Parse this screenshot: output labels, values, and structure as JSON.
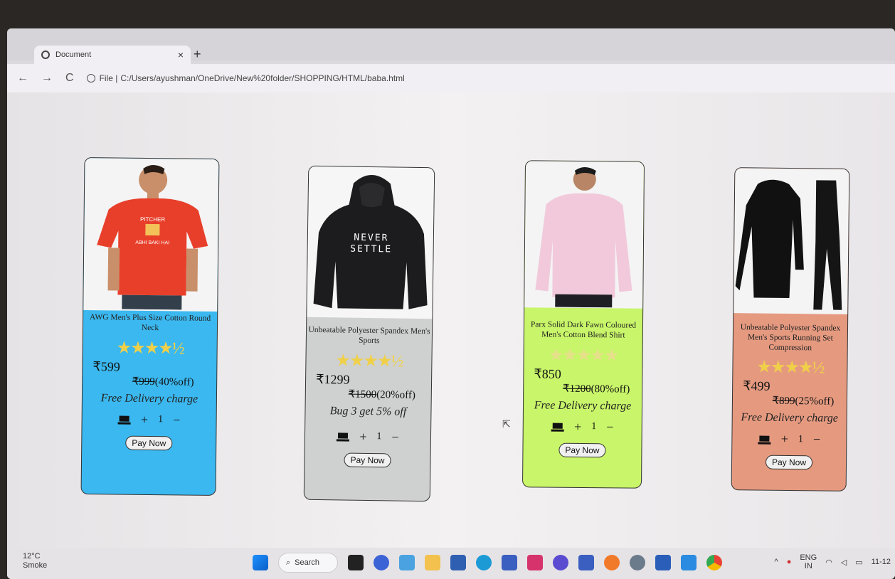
{
  "browser": {
    "tab_title": "Document",
    "tab_close": "×",
    "new_tab": "+",
    "nav_back": "←",
    "nav_forward": "→",
    "nav_reload": "C",
    "file_label": "File |",
    "url": "C:/Users/ayushman/OneDrive/New%20folder/SHOPPING/HTML/baba.html"
  },
  "products": [
    {
      "name": "AWG Men's Plus Size Cotton Round Neck",
      "stars": "★★★★½",
      "price": "₹599",
      "old_price": "₹999",
      "discount": "(40%off)",
      "promo": "Free Delivery charge",
      "qty": "1",
      "plus": "+",
      "minus": "−",
      "pay": "Pay Now",
      "tee_text_1": "PITCHER",
      "tee_text_2": "ABHI BAKI HAI",
      "bg": "#3bb8ef"
    },
    {
      "name": "Unbeatable Polyester Spandex Men's Sports",
      "stars": "★★★★½",
      "price": "₹1299",
      "old_price": "₹1500",
      "discount": "(20%off)",
      "promo": "Bug 3 get 5% off",
      "qty": "1",
      "plus": "+",
      "minus": "−",
      "pay": "Pay Now",
      "hoodie_text_1": "NEVER",
      "hoodie_text_2": "SETTLE",
      "bg": "#cfd1d0"
    },
    {
      "name": "Parx Solid Dark Fawn Coloured Men's Cotton Blend Shirt",
      "stars": "★★★★★",
      "price": "₹850",
      "old_price": "₹1200",
      "discount": "(80%off)",
      "promo": "Free Delivery charge",
      "qty": "1",
      "plus": "+",
      "minus": "−",
      "pay": "Pay Now",
      "bg": "#c9f56a"
    },
    {
      "name": "Unbeatable Polyester Spandex Men's Sports Running Set Compression",
      "stars": "★★★★½",
      "price": "₹499",
      "old_price": "₹899",
      "discount": "(25%off)",
      "promo": "Free Delivery charge",
      "qty": "1",
      "plus": "+",
      "minus": "−",
      "pay": "Pay Now",
      "bg": "#e59a80"
    }
  ],
  "taskbar": {
    "temp": "12°C",
    "weather": "Smoke",
    "search": "Search",
    "lang_1": "ENG",
    "lang_2": "IN",
    "time": "11-12"
  }
}
